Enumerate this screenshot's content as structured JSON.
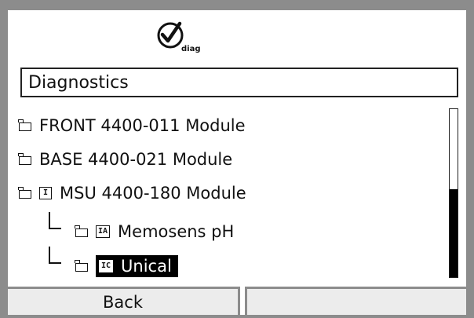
{
  "header": {
    "icon": "diag-check-icon",
    "icon_caption": "diag",
    "title": "Diagnostics"
  },
  "menu": {
    "items": [
      {
        "label": "FRONT 4400-011 Module",
        "icon": "folder-icon"
      },
      {
        "label": "BASE 4400-021 Module",
        "icon": "folder-icon"
      },
      {
        "label": "MSU 4400-180 Module",
        "icon": "folder-icon",
        "badge": "I"
      },
      {
        "label": "Memosens pH",
        "icon": "folder-icon",
        "badge": "IA",
        "child": true
      },
      {
        "label": "Unical",
        "icon": "folder-icon",
        "badge": "IC",
        "child": true,
        "selected": true
      }
    ]
  },
  "softkeys": {
    "left_label": "Back",
    "right_label": ""
  }
}
